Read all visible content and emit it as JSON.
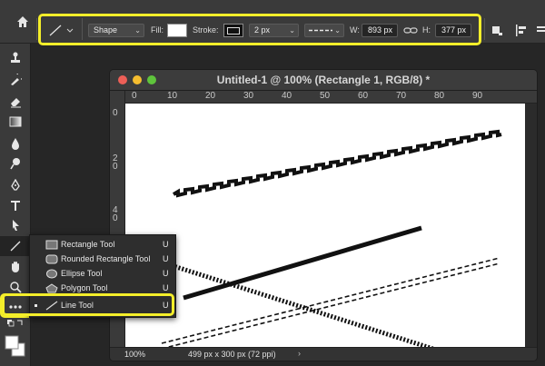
{
  "options_bar": {
    "mode_label": "Shape",
    "fill_label": "Fill:",
    "stroke_label": "Stroke:",
    "stroke_width": "2 px",
    "width_label": "W:",
    "width_value": "893 px",
    "height_label": "H:",
    "height_value": "377 px"
  },
  "document": {
    "title": "Untitled-1 @ 100% (Rectangle 1, RGB/8) *",
    "zoom": "100%",
    "info": "499 px x 300 px (72 ppi)",
    "ruler_top": [
      "0",
      "10",
      "20",
      "30",
      "40",
      "50",
      "60",
      "70",
      "80",
      "90"
    ],
    "ruler_left": [
      "0",
      "2\n0",
      "4\n0"
    ]
  },
  "flyout": {
    "items": [
      {
        "name": "Rectangle Tool",
        "key": "U"
      },
      {
        "name": "Rounded Rectangle Tool",
        "key": "U"
      },
      {
        "name": "Ellipse Tool",
        "key": "U"
      },
      {
        "name": "Polygon Tool",
        "key": "U"
      },
      {
        "name": "Line Tool",
        "key": "U"
      }
    ]
  },
  "colors": {
    "highlight": "#f4ee2a",
    "panel": "#3a3a3a",
    "canvas": "#ffffff"
  }
}
